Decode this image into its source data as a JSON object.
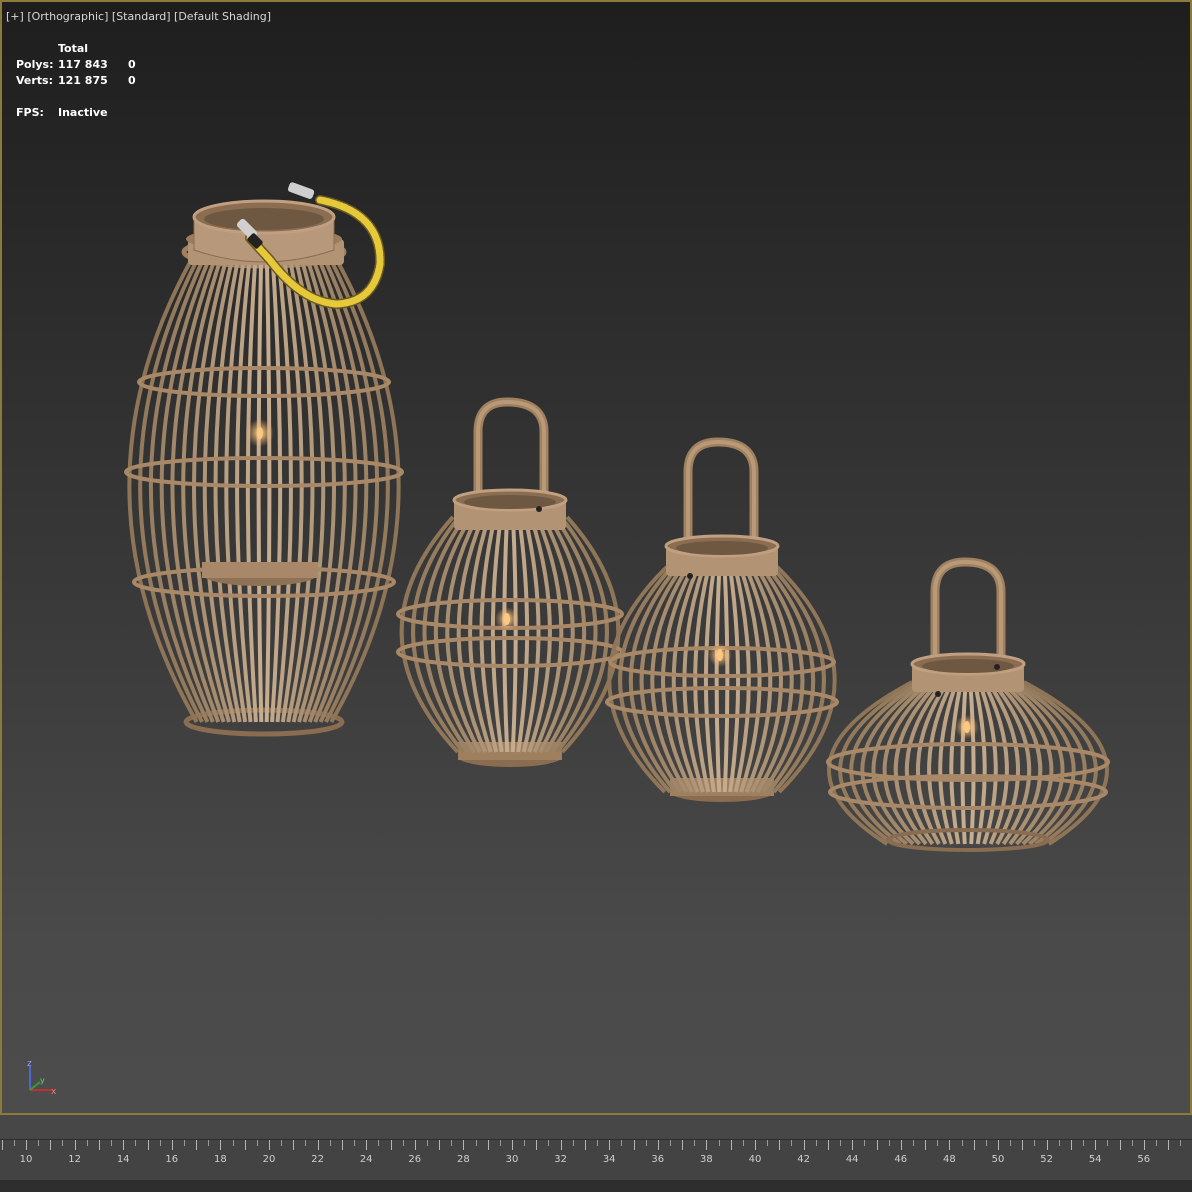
{
  "viewport": {
    "labels": {
      "menu": "[+]",
      "view": "[Orthographic]",
      "renderer": "[Standard]",
      "shading": "[Default Shading]"
    },
    "stats": {
      "header": "Total",
      "polys_label": "Polys:",
      "polys_total": "117 843",
      "polys_selected": "0",
      "verts_label": "Verts:",
      "verts_total": "121 875",
      "verts_selected": "0",
      "fps_label": "FPS:",
      "fps_value": "Inactive"
    },
    "axis_gizmo": {
      "z": "z",
      "x": "x",
      "y": "y"
    },
    "colors": {
      "border": "#8c7a3a",
      "bamboo": "#a08060",
      "rope": "#e6c93a",
      "candle_flame": "#ffc070"
    },
    "objects": [
      {
        "name": "tall bamboo lantern with rope handle"
      },
      {
        "name": "round bamboo lantern"
      },
      {
        "name": "pear-shaped bamboo lantern"
      },
      {
        "name": "flat bamboo lantern"
      }
    ]
  },
  "timeline": {
    "ticks": [
      "10",
      "12",
      "14",
      "16",
      "18",
      "20",
      "22",
      "24",
      "26",
      "28",
      "30",
      "32",
      "34",
      "36",
      "38",
      "40",
      "42",
      "44",
      "46",
      "48",
      "50",
      "52",
      "54",
      "56"
    ]
  }
}
